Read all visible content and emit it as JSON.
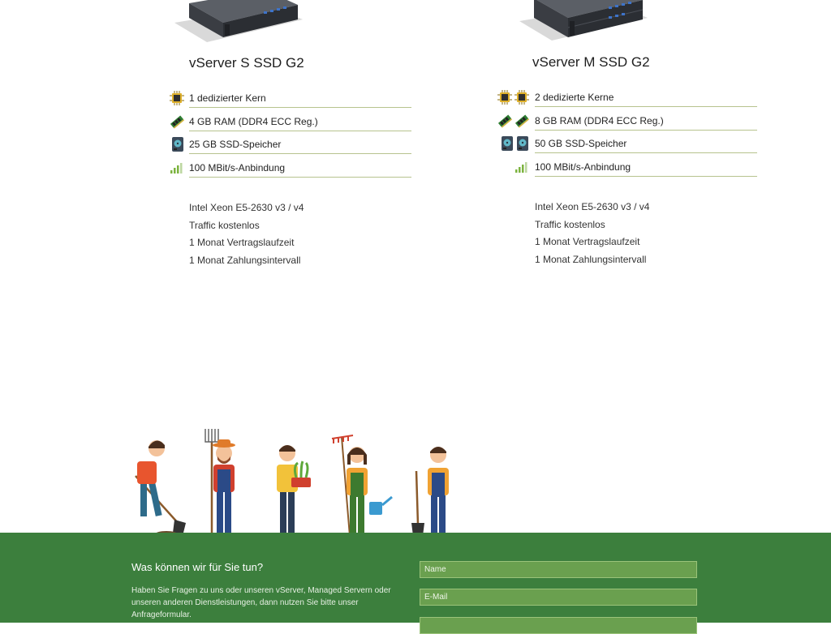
{
  "plans": [
    {
      "title": "vServer S SSD G2",
      "specs": [
        {
          "icon": "cpu-chip-icon",
          "text": "1 dedizierter Kern"
        },
        {
          "icon": "ram-module-icon",
          "text": "4 GB RAM (DDR4 ECC Reg.)"
        },
        {
          "icon": "ssd-drive-icon",
          "text": "25 GB SSD-Speicher"
        },
        {
          "icon": "signal-bars-icon",
          "text": "100 MBit/s-Anbindung"
        }
      ],
      "features": [
        "Intel Xeon E5-2630 v3 / v4",
        "Traffic kostenlos",
        "1 Monat Vertragslaufzeit",
        "1 Monat Zahlungsintervall"
      ]
    },
    {
      "title": "vServer M SSD G2",
      "specs": [
        {
          "icon": "cpu-chip-icon",
          "text": "2 dedizierte Kerne"
        },
        {
          "icon": "ram-module-icon",
          "text": "8 GB RAM (DDR4 ECC Reg.)"
        },
        {
          "icon": "ssd-drive-icon",
          "text": "50 GB SSD-Speicher"
        },
        {
          "icon": "signal-bars-icon",
          "text": "100 MBit/s-Anbindung"
        }
      ],
      "features": [
        "Intel Xeon E5-2630 v3 / v4",
        "Traffic kostenlos",
        "1 Monat Vertragslaufzeit",
        "1 Monat Zahlungsintervall"
      ]
    }
  ],
  "contact": {
    "heading": "Was können wir für Sie tun?",
    "text": "Haben Sie Fragen zu uns oder unseren vServer, Managed Servern oder unseren anderen Dienstleistungen, dann nutzen Sie bitte unser Anfrageformular.",
    "name_placeholder": "Name",
    "email_placeholder": "E-Mail"
  },
  "colors": {
    "footer_green": "#3c7f3d",
    "field_green": "#6aa04f",
    "divider": "#b7c38e",
    "signal_green": "#7cb33f"
  }
}
